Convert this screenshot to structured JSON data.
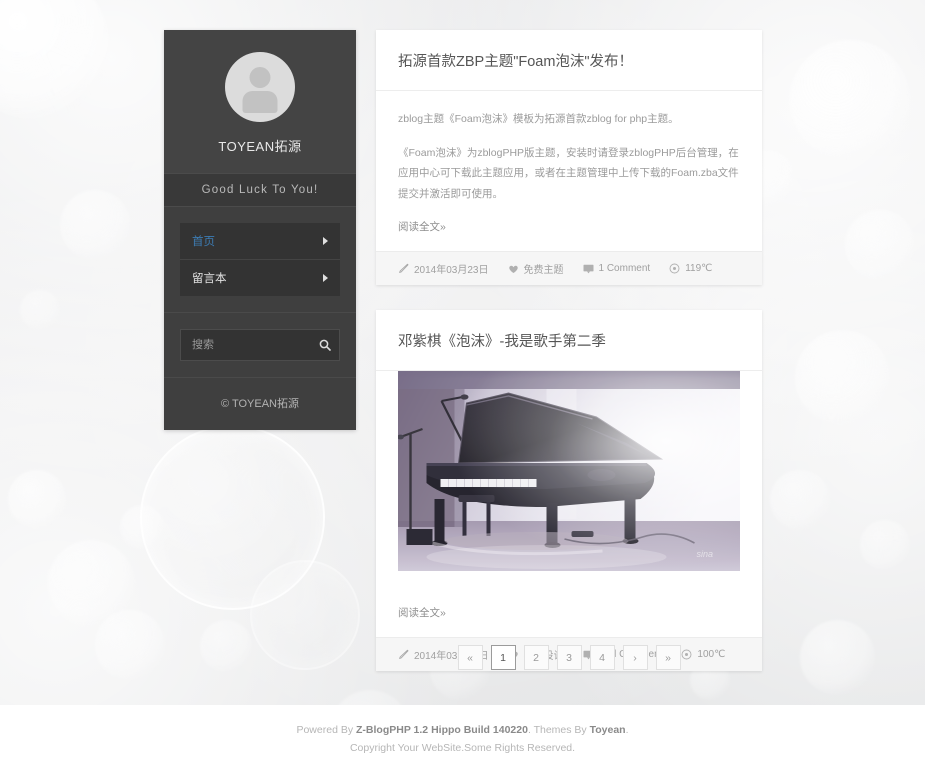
{
  "theme": {
    "sidebar_bg": "#3f3f3f",
    "sidebar_head_bg": "#444444",
    "accent": "#3d7cb3",
    "page_bg": "#e9eaea",
    "card_bg": "#ffffff",
    "meta_bg": "#f6f6f6"
  },
  "sidebar": {
    "avatar_alt": "user-avatar",
    "site_name": "TOYEAN拓源",
    "motto": "Good Luck To You!",
    "nav": [
      {
        "label": "首页",
        "active": true
      },
      {
        "label": "留言本",
        "active": false
      }
    ],
    "search": {
      "placeholder": "搜索",
      "value": "",
      "icon": "search-icon"
    },
    "copyright": "© TOYEAN拓源"
  },
  "posts": [
    {
      "title": "拓源首款ZBP主题\"Foam泡沫\"发布！",
      "paragraphs": [
        "zblog主题《Foam泡沫》模板为拓源首款zblog for php主题。",
        "《Foam泡沫》为zblogPHP版主题，安装时请登录zblogPHP后台管理，在应用中心可下载此主题应用，或者在主题管理中上传下载的Foam.zba文件提交并激活即可使用。"
      ],
      "read_more": "阅读全文»",
      "has_image": false,
      "meta": {
        "date": "2014年03月23日",
        "category": "免费主题",
        "comments": "1 Comment",
        "views": "119℃"
      }
    },
    {
      "title": "邓紫棋《泡沫》-我是歌手第二季",
      "paragraphs": [],
      "read_more": "阅读全文»",
      "has_image": true,
      "image_alt": "singer-at-grand-piano-photo",
      "meta": {
        "date": "2014年03月23日",
        "category": "视觉设计",
        "comments": "Add Comment",
        "views": "100℃"
      }
    }
  ],
  "pagination": {
    "first_label": "«",
    "prev_label": "‹",
    "next_label": "›",
    "last_label": "»",
    "pages": [
      "1",
      "2",
      "3",
      "4"
    ],
    "current": "1"
  },
  "footer": {
    "line1_prefix": "Powered By ",
    "line1_engine": "Z-BlogPHP 1.2 Hippo Build 140220",
    "line1_mid": ". Themes By ",
    "line1_author": "Toyean",
    "line1_suffix": ".",
    "line2": "Copyright Your WebSite.Some Rights Reserved."
  }
}
